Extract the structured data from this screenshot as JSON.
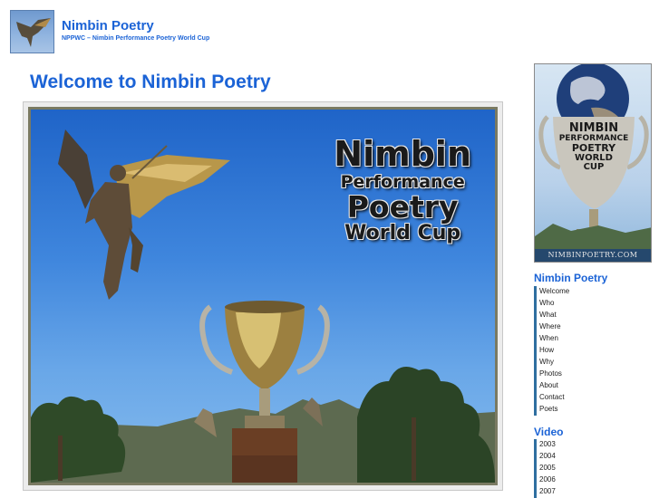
{
  "header": {
    "site_title": "Nimbin Poetry",
    "tagline": "NPPWC – Nimbin Performance Poetry World Cup"
  },
  "main": {
    "page_title": "Welcome to Nimbin Poetry",
    "hero_lines": [
      "Nimbin",
      "Performance",
      "Poetry",
      "World Cup"
    ]
  },
  "sidebar": {
    "badge_lines": [
      "NIMBIN",
      "PERFORMANCE",
      "POETRY",
      "WORLD",
      "CUP"
    ],
    "badge_footer": "NIMBINPOETRY.COM",
    "nav_heading": "Nimbin Poetry",
    "nav_items": [
      "Welcome",
      "Who",
      "What",
      "Where",
      "When",
      "How",
      "Why",
      "Photos",
      "About",
      "Contact",
      "Poets"
    ],
    "video_heading": "Video",
    "video_items": [
      "2003",
      "2004",
      "2005",
      "2006",
      "2007"
    ]
  },
  "colors": {
    "link_blue": "#1b63d6",
    "nav_bar": "#2f6fa0",
    "sky_top": "#1f64c8",
    "sky_bottom": "#86bbed"
  },
  "icons": {
    "logo": "winged-angel-icon",
    "hero": "angel-and-trophy-photo",
    "side": "globe-trophy-badge"
  }
}
